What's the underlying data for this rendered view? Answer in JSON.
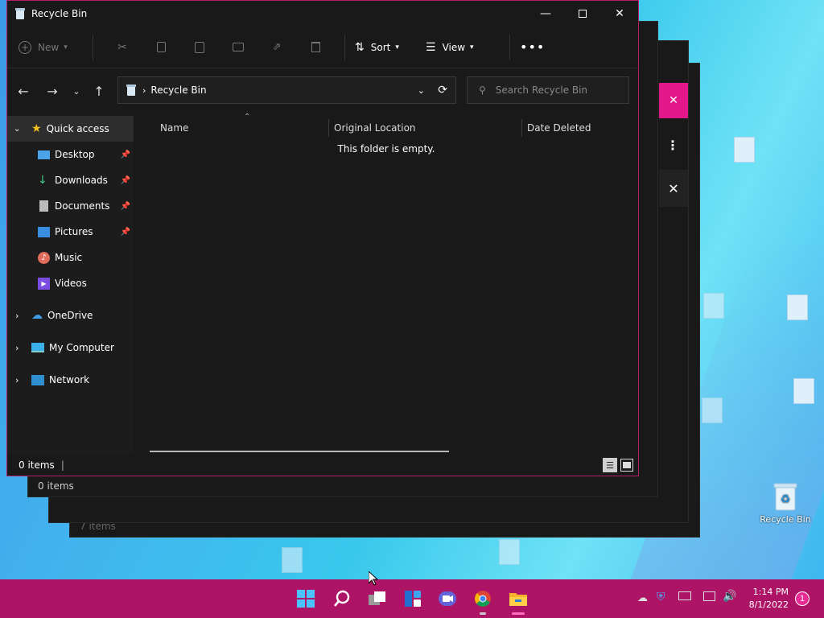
{
  "window": {
    "title": "Recycle Bin",
    "controls": [
      "minimize",
      "maximize",
      "close"
    ]
  },
  "toolbar": {
    "new_label": "New",
    "sort_label": "Sort",
    "view_label": "View"
  },
  "address": {
    "path": "Recycle Bin",
    "search_placeholder": "Search Recycle Bin"
  },
  "sidebar": {
    "quick_access": "Quick access",
    "items": [
      {
        "label": "Desktop",
        "pinned": true
      },
      {
        "label": "Downloads",
        "pinned": true
      },
      {
        "label": "Documents",
        "pinned": true
      },
      {
        "label": "Pictures",
        "pinned": true
      },
      {
        "label": "Music",
        "pinned": false
      },
      {
        "label": "Videos",
        "pinned": false
      }
    ],
    "roots": [
      {
        "label": "OneDrive"
      },
      {
        "label": "My Computer"
      },
      {
        "label": "Network"
      }
    ]
  },
  "list": {
    "columns": [
      "Name",
      "Original Location",
      "Date Deleted"
    ],
    "empty_text": "This folder is empty."
  },
  "status": {
    "count": "0 items"
  },
  "ghosts": {
    "count_1": "0 items",
    "count_2": "7 items"
  },
  "desktop": {
    "recycle_label": "Recycle Bin"
  },
  "taskbar": {
    "time": "1:14 PM",
    "date": "8/1/2022",
    "notifications": "1"
  },
  "colors": {
    "accent": "#ad1466",
    "window_bg": "#191919",
    "border": "#b0206e"
  }
}
